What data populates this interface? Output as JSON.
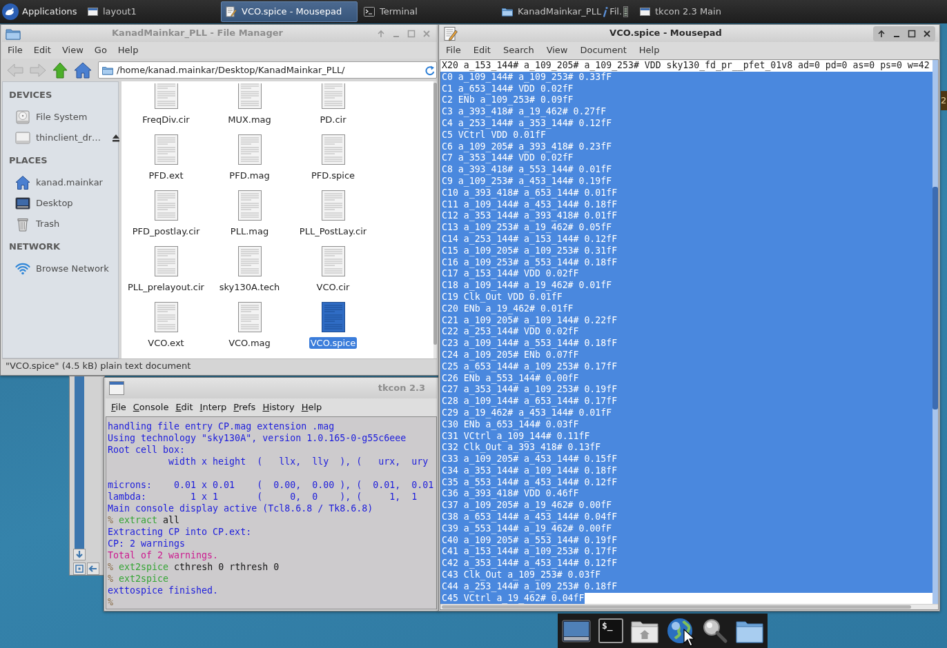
{
  "panel": {
    "menu_button": "Applications",
    "tasks": [
      {
        "kind": "window",
        "label": "layout1",
        "selected": false
      },
      {
        "kind": "editor",
        "label": "VCO.spice - Mousepad",
        "selected": true
      },
      {
        "kind": "terminal",
        "label": "Terminal",
        "selected": false
      },
      {
        "kind": "folder",
        "label": "KanadMainkar_PLL",
        "suffix": "Fil.",
        "selected": false
      },
      {
        "kind": "window",
        "label": "tkcon 2.3 Main",
        "selected": false
      }
    ]
  },
  "file_manager": {
    "title": "KanadMainkar_PLL - File Manager",
    "active": false,
    "menu": [
      "File",
      "Edit",
      "View",
      "Go",
      "Help"
    ],
    "toolbar": [
      {
        "kind": "back",
        "disabled": true
      },
      {
        "kind": "forward",
        "disabled": true
      },
      {
        "kind": "up",
        "disabled": false
      },
      {
        "kind": "home",
        "disabled": false
      }
    ],
    "location": "/home/kanad.mainkar/Desktop/KanadMainkar_PLL/",
    "sidebar": [
      {
        "heading": "DEVICES",
        "items": [
          {
            "kind": "drive",
            "label": "File System"
          },
          {
            "kind": "removable",
            "label": "thinclient_dr…"
          }
        ]
      },
      {
        "heading": "PLACES",
        "items": [
          {
            "kind": "home",
            "label": "kanad.mainkar"
          },
          {
            "kind": "desktop",
            "label": "Desktop"
          },
          {
            "kind": "trash",
            "label": "Trash"
          }
        ]
      },
      {
        "heading": "NETWORK",
        "items": [
          {
            "kind": "network",
            "label": "Browse Network"
          }
        ]
      }
    ],
    "files": [
      {
        "name": "FreqDiv.cir",
        "selected": false
      },
      {
        "name": "MUX.mag",
        "selected": false
      },
      {
        "name": "PD.cir",
        "selected": false
      },
      {
        "name": "PFD.ext",
        "selected": false
      },
      {
        "name": "PFD.mag",
        "selected": false
      },
      {
        "name": "PFD.spice",
        "selected": false
      },
      {
        "name": "PFD_postlay.cir",
        "selected": false
      },
      {
        "name": "PLL.mag",
        "selected": false
      },
      {
        "name": "PLL_PostLay.cir",
        "selected": false
      },
      {
        "name": "PLL_prelayout.cir",
        "selected": false
      },
      {
        "name": "sky130A.tech",
        "selected": false
      },
      {
        "name": "VCO.cir",
        "selected": false
      },
      {
        "name": "VCO.ext",
        "selected": false
      },
      {
        "name": "VCO.mag",
        "selected": false
      },
      {
        "name": "VCO.spice",
        "selected": true
      }
    ],
    "status": "\"VCO.spice\" (4.5 kB) plain text document"
  },
  "tkcon": {
    "title": "tkcon 2.3",
    "active": false,
    "menu": [
      "File",
      "Console",
      "Edit",
      "Interp",
      "Prefs",
      "History",
      "Help"
    ],
    "lines": [
      {
        "kind": "text",
        "segments": [
          {
            "kind": "output",
            "text": "handling file entry CP.mag extension .mag"
          }
        ]
      },
      {
        "kind": "text",
        "segments": [
          {
            "kind": "output",
            "text": "Using technology \"sky130A\", version 1.0.165-0-g55c6eee"
          }
        ]
      },
      {
        "kind": "text",
        "segments": [
          {
            "kind": "output",
            "text": "Root cell box:"
          }
        ]
      },
      {
        "kind": "text",
        "segments": [
          {
            "kind": "output",
            "text": "           width x height  (   llx,  lly  ), (   urx,  ury"
          }
        ]
      },
      {
        "kind": "blank"
      },
      {
        "kind": "text",
        "segments": [
          {
            "kind": "output",
            "text": "microns:    0.01 x 0.01    (  0.00,  0.00 ), (  0.01,  0.01"
          }
        ]
      },
      {
        "kind": "text",
        "segments": [
          {
            "kind": "output",
            "text": "lambda:        1 x 1       (     0,  0    ), (     1,  1"
          }
        ]
      },
      {
        "kind": "text",
        "segments": [
          {
            "kind": "output",
            "text": "Main console display active (Tcl8.6.8 / Tk8.6.8)"
          }
        ]
      },
      {
        "kind": "text",
        "segments": [
          {
            "kind": "prompt",
            "text": "%"
          },
          {
            "kind": "command",
            "text": "extract"
          },
          {
            "kind": "arg",
            "text": "all"
          }
        ]
      },
      {
        "kind": "text",
        "segments": [
          {
            "kind": "output",
            "text": "Extracting CP into CP.ext:"
          }
        ]
      },
      {
        "kind": "text",
        "segments": [
          {
            "kind": "output",
            "text": "CP: 2 warnings"
          }
        ]
      },
      {
        "kind": "text",
        "segments": [
          {
            "kind": "error",
            "text": "Total of 2 warnings."
          }
        ]
      },
      {
        "kind": "text",
        "segments": [
          {
            "kind": "prompt",
            "text": "%"
          },
          {
            "kind": "command",
            "text": "ext2spice"
          },
          {
            "kind": "arg",
            "text": "cthresh 0 rthresh 0"
          }
        ]
      },
      {
        "kind": "text",
        "segments": [
          {
            "kind": "prompt",
            "text": "%"
          },
          {
            "kind": "command",
            "text": "ext2spice"
          }
        ]
      },
      {
        "kind": "text",
        "segments": [
          {
            "kind": "output",
            "text": "exttospice finished."
          }
        ]
      },
      {
        "kind": "text",
        "segments": [
          {
            "kind": "prompt",
            "text": "%"
          }
        ]
      }
    ]
  },
  "mousepad": {
    "title": "VCO.spice - Mousepad",
    "active": true,
    "menu": [
      "File",
      "Edit",
      "Search",
      "View",
      "Document",
      "Help"
    ],
    "lines": [
      {
        "text": "X20 a_153_144# a_109_205# a_109_253# VDD sky130_fd_pr__pfet_01v8 ad=0 pd=0 as=0 ps=0 w=42",
        "selected": false
      },
      {
        "text": "C0 a_109_144# a_109_253# 0.33fF",
        "selected": true
      },
      {
        "text": "C1 a_653_144# VDD 0.02fF",
        "selected": true
      },
      {
        "text": "C2 ENb a_109_253# 0.09fF",
        "selected": true
      },
      {
        "text": "C3 a_393_418# a_19_462# 0.27fF",
        "selected": true
      },
      {
        "text": "C4 a_253_144# a_353_144# 0.12fF",
        "selected": true
      },
      {
        "text": "C5 VCtrl VDD 0.01fF",
        "selected": true
      },
      {
        "text": "C6 a_109_205# a_393_418# 0.23fF",
        "selected": true
      },
      {
        "text": "C7 a_353_144# VDD 0.02fF",
        "selected": true
      },
      {
        "text": "C8 a_393_418# a_553_144# 0.01fF",
        "selected": true
      },
      {
        "text": "C9 a_109_253# a_453_144# 0.19fF",
        "selected": true
      },
      {
        "text": "C10 a_393_418# a_653_144# 0.01fF",
        "selected": true
      },
      {
        "text": "C11 a_109_144# a_453_144# 0.18fF",
        "selected": true
      },
      {
        "text": "C12 a_353_144# a_393_418# 0.01fF",
        "selected": true
      },
      {
        "text": "C13 a_109_253# a_19_462# 0.05fF",
        "selected": true
      },
      {
        "text": "C14 a_253_144# a_153_144# 0.12fF",
        "selected": true
      },
      {
        "text": "C15 a_109_205# a_109_253# 0.31fF",
        "selected": true
      },
      {
        "text": "C16 a_109_253# a_553_144# 0.18fF",
        "selected": true
      },
      {
        "text": "C17 a_153_144# VDD 0.02fF",
        "selected": true
      },
      {
        "text": "C18 a_109_144# a_19_462# 0.01fF",
        "selected": true
      },
      {
        "text": "C19 Clk_Out VDD 0.01fF",
        "selected": true
      },
      {
        "text": "C20 ENb a_19_462# 0.01fF",
        "selected": true
      },
      {
        "text": "C21 a_109_205# a_109_144# 0.22fF",
        "selected": true
      },
      {
        "text": "C22 a_253_144# VDD 0.02fF",
        "selected": true
      },
      {
        "text": "C23 a_109_144# a_553_144# 0.18fF",
        "selected": true
      },
      {
        "text": "C24 a_109_205# ENb 0.07fF",
        "selected": true
      },
      {
        "text": "C25 a_653_144# a_109_253# 0.17fF",
        "selected": true
      },
      {
        "text": "C26 ENb a_553_144# 0.00fF",
        "selected": true
      },
      {
        "text": "C27 a_353_144# a_109_253# 0.19fF",
        "selected": true
      },
      {
        "text": "C28 a_109_144# a_653_144# 0.17fF",
        "selected": true
      },
      {
        "text": "C29 a_19_462# a_453_144# 0.01fF",
        "selected": true
      },
      {
        "text": "C30 ENb a_653_144# 0.03fF",
        "selected": true
      },
      {
        "text": "C31 VCtrl a_109_144# 0.11fF",
        "selected": true
      },
      {
        "text": "C32 Clk_Out a_393_418# 0.13fF",
        "selected": true
      },
      {
        "text": "C33 a_109_205# a_453_144# 0.15fF",
        "selected": true
      },
      {
        "text": "C34 a_353_144# a_109_144# 0.18fF",
        "selected": true
      },
      {
        "text": "C35 a_553_144# a_453_144# 0.12fF",
        "selected": true
      },
      {
        "text": "C36 a_393_418# VDD 0.46fF",
        "selected": true
      },
      {
        "text": "C37 a_109_205# a_19_462# 0.00fF",
        "selected": true
      },
      {
        "text": "C38 a_653_144# a_453_144# 0.04fF",
        "selected": true
      },
      {
        "text": "C39 a_553_144# a_19_462# 0.00fF",
        "selected": true
      },
      {
        "text": "C40 a_109_205# a_553_144# 0.19fF",
        "selected": true
      },
      {
        "text": "C41 a_153_144# a_109_253# 0.17fF",
        "selected": true
      },
      {
        "text": "C42 a_353_144# a_453_144# 0.12fF",
        "selected": true
      },
      {
        "text": "C43 Clk_Out a_109_253# 0.03fF",
        "selected": true
      },
      {
        "text": "C44 a_253_144# a_109_253# 0.18fF",
        "selected": true
      },
      {
        "text": "C45 VCtrl a_19_462# 0.04fF",
        "selected": true
      }
    ]
  },
  "edge_window": {
    "text": "2"
  },
  "dock": {
    "items": [
      {
        "kind": "desktop"
      },
      {
        "kind": "terminal",
        "glyph": "$_"
      },
      {
        "kind": "home"
      },
      {
        "kind": "browser"
      },
      {
        "kind": "search"
      },
      {
        "kind": "files"
      }
    ]
  }
}
